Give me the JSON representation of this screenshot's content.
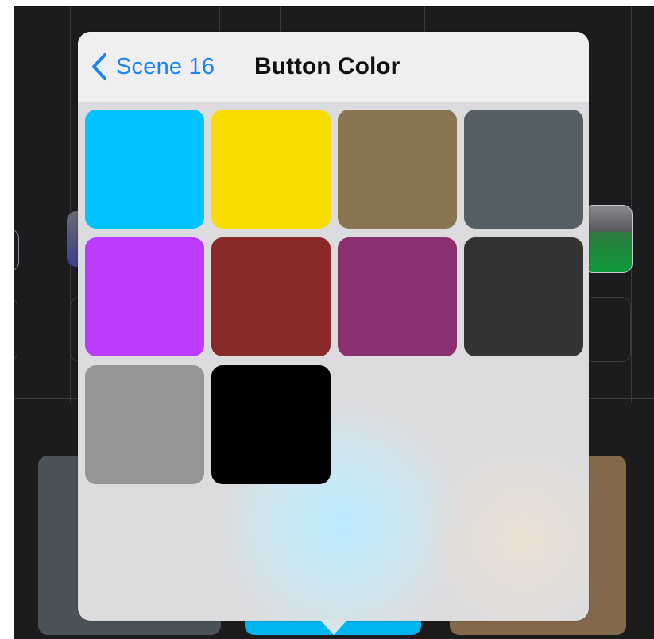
{
  "popover": {
    "back_label": "Scene 16",
    "title": "Button Color"
  },
  "swatches": [
    {
      "name": "cyan",
      "color": "#00c2ff"
    },
    {
      "name": "yellow",
      "color": "#f8dc00"
    },
    {
      "name": "brown",
      "color": "#8a7552"
    },
    {
      "name": "slate",
      "color": "#545e65"
    },
    {
      "name": "violet",
      "color": "#bb3cff"
    },
    {
      "name": "dark-red",
      "color": "#872a29"
    },
    {
      "name": "plum",
      "color": "#8a2f70"
    },
    {
      "name": "charcoal",
      "color": "#333333"
    },
    {
      "name": "gray",
      "color": "#959595"
    },
    {
      "name": "black",
      "color": "#000000"
    }
  ],
  "colors": {
    "accent": "#1a82f7",
    "background": "#1c1c1e"
  }
}
